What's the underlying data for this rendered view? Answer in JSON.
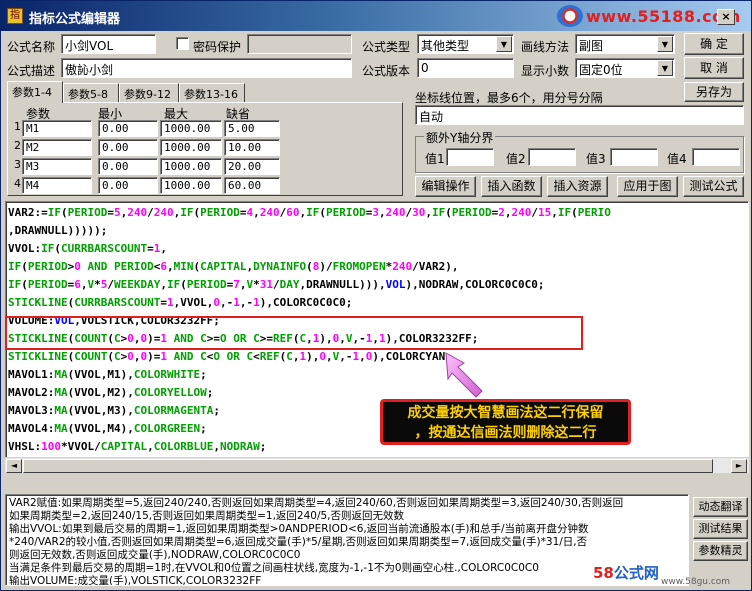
{
  "window": {
    "title": "指标公式编辑器",
    "watermark": "www.55188.com",
    "close_label": "×"
  },
  "form": {
    "name_label": "公式名称",
    "name_value": "小剑VOL",
    "password_label": "密码保护",
    "password_value": "",
    "desc_label": "公式描述",
    "desc_value": "傲訫小剑",
    "type_label": "公式类型",
    "type_value": "其他类型",
    "draw_label": "画线方法",
    "draw_value": "副图",
    "version_label": "公式版本",
    "version_value": "0",
    "decimals_label": "显示小数",
    "decimals_value": "固定0位",
    "confirm_label": "确  定",
    "cancel_label": "取  消",
    "saveas_label": "另存为"
  },
  "tabs": [
    "参数1-4",
    "参数5-8",
    "参数9-12",
    "参数13-16"
  ],
  "params": {
    "headers": [
      "参数",
      "最小",
      "最大",
      "缺省"
    ],
    "rows": [
      {
        "num": "1",
        "name": "M1",
        "min": "0.00",
        "max": "1000.00",
        "default": "5.00"
      },
      {
        "num": "2",
        "name": "M2",
        "min": "0.00",
        "max": "1000.00",
        "default": "10.00"
      },
      {
        "num": "3",
        "name": "M3",
        "min": "0.00",
        "max": "1000.00",
        "default": "20.00"
      },
      {
        "num": "4",
        "name": "M4",
        "min": "0.00",
        "max": "1000.00",
        "default": "60.00"
      }
    ]
  },
  "coords": {
    "label": "坐标线位置，最多6个，用分号分隔",
    "value": "自动"
  },
  "yaxis": {
    "legend": "额外Y轴分界",
    "labels": [
      "值1",
      "值2",
      "值3",
      "值4"
    ]
  },
  "toolbar": {
    "edit": "编辑操作",
    "insert_fn": "插入函数",
    "insert_res": "插入资源",
    "apply": "应用于图",
    "test": "测试公式"
  },
  "code_lines": [
    [
      {
        "t": "VAR2:="
      },
      {
        "t": "IF",
        "c": "fn"
      },
      {
        "t": "("
      },
      {
        "t": "PERIOD",
        "c": "fn"
      },
      {
        "t": "="
      },
      {
        "t": "5",
        "c": "num"
      },
      {
        "t": ","
      },
      {
        "t": "240",
        "c": "num"
      },
      {
        "t": "/"
      },
      {
        "t": "240",
        "c": "num"
      },
      {
        "t": ","
      },
      {
        "t": "IF",
        "c": "fn"
      },
      {
        "t": "("
      },
      {
        "t": "PERIOD",
        "c": "fn"
      },
      {
        "t": "="
      },
      {
        "t": "4",
        "c": "num"
      },
      {
        "t": ","
      },
      {
        "t": "240",
        "c": "num"
      },
      {
        "t": "/"
      },
      {
        "t": "60",
        "c": "num"
      },
      {
        "t": ","
      },
      {
        "t": "IF",
        "c": "fn"
      },
      {
        "t": "("
      },
      {
        "t": "PERIOD",
        "c": "fn"
      },
      {
        "t": "="
      },
      {
        "t": "3",
        "c": "num"
      },
      {
        "t": ","
      },
      {
        "t": "240",
        "c": "num"
      },
      {
        "t": "/"
      },
      {
        "t": "30",
        "c": "num"
      },
      {
        "t": ","
      },
      {
        "t": "IF",
        "c": "fn"
      },
      {
        "t": "("
      },
      {
        "t": "PERIOD",
        "c": "fn"
      },
      {
        "t": "="
      },
      {
        "t": "2",
        "c": "num"
      },
      {
        "t": ","
      },
      {
        "t": "240",
        "c": "num"
      },
      {
        "t": "/"
      },
      {
        "t": "15",
        "c": "num"
      },
      {
        "t": ","
      },
      {
        "t": "IF",
        "c": "fn"
      },
      {
        "t": "("
      },
      {
        "t": "PERIO",
        "c": "fn"
      }
    ],
    [
      {
        "t": ",DRAWNULL)))));"
      }
    ],
    [
      {
        "t": "VVOL:"
      },
      {
        "t": "IF",
        "c": "fn"
      },
      {
        "t": "("
      },
      {
        "t": "CURRBARSCOUNT",
        "c": "fn"
      },
      {
        "t": "="
      },
      {
        "t": "1",
        "c": "num"
      },
      {
        "t": ","
      }
    ],
    [
      {
        "t": "IF",
        "c": "fn"
      },
      {
        "t": "("
      },
      {
        "t": "PERIOD",
        "c": "fn"
      },
      {
        "t": ">"
      },
      {
        "t": "0",
        "c": "num"
      },
      {
        "t": " AND ",
        "c": "fn"
      },
      {
        "t": "PERIOD",
        "c": "fn"
      },
      {
        "t": "<"
      },
      {
        "t": "6",
        "c": "num"
      },
      {
        "t": ","
      },
      {
        "t": "MIN",
        "c": "fn"
      },
      {
        "t": "("
      },
      {
        "t": "CAPITAL",
        "c": "fn"
      },
      {
        "t": ","
      },
      {
        "t": "DYNAINFO",
        "c": "fn"
      },
      {
        "t": "("
      },
      {
        "t": "8",
        "c": "num"
      },
      {
        "t": ")/"
      },
      {
        "t": "FROMOPEN",
        "c": "fn"
      },
      {
        "t": "*"
      },
      {
        "t": "240",
        "c": "num"
      },
      {
        "t": "/VAR2),"
      }
    ],
    [
      {
        "t": "IF",
        "c": "fn"
      },
      {
        "t": "("
      },
      {
        "t": "PERIOD",
        "c": "fn"
      },
      {
        "t": "="
      },
      {
        "t": "6",
        "c": "num"
      },
      {
        "t": ","
      },
      {
        "t": "V",
        "c": "fn"
      },
      {
        "t": "*"
      },
      {
        "t": "5",
        "c": "num"
      },
      {
        "t": "/"
      },
      {
        "t": "WEEKDAY",
        "c": "fn"
      },
      {
        "t": ","
      },
      {
        "t": "IF",
        "c": "fn"
      },
      {
        "t": "("
      },
      {
        "t": "PERIOD",
        "c": "fn"
      },
      {
        "t": "="
      },
      {
        "t": "7",
        "c": "num"
      },
      {
        "t": ","
      },
      {
        "t": "V",
        "c": "fn"
      },
      {
        "t": "*"
      },
      {
        "t": "31",
        "c": "num"
      },
      {
        "t": "/"
      },
      {
        "t": "DAY",
        "c": "fn"
      },
      {
        "t": ",DRAWNULL))),"
      },
      {
        "t": "VOL",
        "c": "var"
      },
      {
        "t": "),NODRAW,COLORC0C0C0;"
      }
    ],
    [
      {
        "t": "STICKLINE",
        "c": "fn"
      },
      {
        "t": "("
      },
      {
        "t": "CURRBARSCOUNT",
        "c": "fn"
      },
      {
        "t": "="
      },
      {
        "t": "1",
        "c": "num"
      },
      {
        "t": ",VVOL,"
      },
      {
        "t": "0",
        "c": "num"
      },
      {
        "t": ",-"
      },
      {
        "t": "1",
        "c": "num"
      },
      {
        "t": ",-"
      },
      {
        "t": "1",
        "c": "num"
      },
      {
        "t": "),COLORC0C0C0;"
      }
    ],
    [
      {
        "t": "VOLUME:"
      },
      {
        "t": "VOL",
        "c": "var"
      },
      {
        "t": ",VOLSTICK,COLOR3232FF;"
      }
    ],
    [
      {
        "t": "STICKLINE",
        "c": "fn"
      },
      {
        "t": "("
      },
      {
        "t": "COUNT",
        "c": "fn"
      },
      {
        "t": "("
      },
      {
        "t": "C",
        "c": "fn"
      },
      {
        "t": ">"
      },
      {
        "t": "0",
        "c": "num"
      },
      {
        "t": ","
      },
      {
        "t": "0",
        "c": "num"
      },
      {
        "t": ")="
      },
      {
        "t": "1",
        "c": "num"
      },
      {
        "t": " AND ",
        "c": "fn"
      },
      {
        "t": "C",
        "c": "fn"
      },
      {
        "t": ">="
      },
      {
        "t": "O",
        "c": "fn"
      },
      {
        "t": " OR ",
        "c": "fn"
      },
      {
        "t": "C",
        "c": "fn"
      },
      {
        "t": ">="
      },
      {
        "t": "REF",
        "c": "fn"
      },
      {
        "t": "("
      },
      {
        "t": "C",
        "c": "fn"
      },
      {
        "t": ","
      },
      {
        "t": "1",
        "c": "num"
      },
      {
        "t": "),"
      },
      {
        "t": "0",
        "c": "num"
      },
      {
        "t": ","
      },
      {
        "t": "V",
        "c": "fn"
      },
      {
        "t": ",-"
      },
      {
        "t": "1",
        "c": "num"
      },
      {
        "t": ","
      },
      {
        "t": "1",
        "c": "num"
      },
      {
        "t": "),COLOR3232FF;"
      }
    ],
    [
      {
        "t": "STICKLINE",
        "c": "fn"
      },
      {
        "t": "("
      },
      {
        "t": "COUNT",
        "c": "fn"
      },
      {
        "t": "("
      },
      {
        "t": "C",
        "c": "fn"
      },
      {
        "t": ">"
      },
      {
        "t": "0",
        "c": "num"
      },
      {
        "t": ","
      },
      {
        "t": "0",
        "c": "num"
      },
      {
        "t": ")="
      },
      {
        "t": "1",
        "c": "num"
      },
      {
        "t": " AND ",
        "c": "fn"
      },
      {
        "t": "C",
        "c": "fn"
      },
      {
        "t": "<"
      },
      {
        "t": "O",
        "c": "fn"
      },
      {
        "t": " OR ",
        "c": "fn"
      },
      {
        "t": "C",
        "c": "fn"
      },
      {
        "t": "<"
      },
      {
        "t": "REF",
        "c": "fn"
      },
      {
        "t": "("
      },
      {
        "t": "C",
        "c": "fn"
      },
      {
        "t": ","
      },
      {
        "t": "1",
        "c": "num"
      },
      {
        "t": "),"
      },
      {
        "t": "0",
        "c": "num"
      },
      {
        "t": ","
      },
      {
        "t": "V",
        "c": "fn"
      },
      {
        "t": ",-"
      },
      {
        "t": "1",
        "c": "num"
      },
      {
        "t": ","
      },
      {
        "t": "0",
        "c": "num"
      },
      {
        "t": "),COLORCYAN;"
      }
    ],
    [
      {
        "t": "MAVOL1:"
      },
      {
        "t": "MA",
        "c": "fn"
      },
      {
        "t": "(VVOL,M1),"
      },
      {
        "t": "COLORWHITE",
        "c": "fn"
      },
      {
        "t": ";"
      }
    ],
    [
      {
        "t": "MAVOL2:"
      },
      {
        "t": "MA",
        "c": "fn"
      },
      {
        "t": "(VVOL,M2),"
      },
      {
        "t": "COLORYELLOW",
        "c": "fn"
      },
      {
        "t": ";"
      }
    ],
    [
      {
        "t": "MAVOL3:"
      },
      {
        "t": "MA",
        "c": "fn"
      },
      {
        "t": "(VVOL,M3),"
      },
      {
        "t": "COLORMAGENTA",
        "c": "fn"
      },
      {
        "t": ";"
      }
    ],
    [
      {
        "t": "MAVOL4:"
      },
      {
        "t": "MA",
        "c": "fn"
      },
      {
        "t": "(VVOL,M4),"
      },
      {
        "t": "COLORGREEN",
        "c": "fn"
      },
      {
        "t": ";"
      }
    ],
    [
      {
        "t": "VHSL:"
      },
      {
        "t": "100",
        "c": "num"
      },
      {
        "t": "*VVOL/"
      },
      {
        "t": "CAPITAL",
        "c": "fn"
      },
      {
        "t": ","
      },
      {
        "t": "COLORBLUE",
        "c": "fn"
      },
      {
        "t": ","
      },
      {
        "t": "NODRAW",
        "c": "fn"
      },
      {
        "t": ";"
      }
    ],
    [
      {
        "t": "VAMT:VVOL/"
      },
      {
        "t": "V",
        "c": "fn"
      },
      {
        "t": "*"
      },
      {
        "t": "AMOUNT",
        "c": "fn"
      },
      {
        "t": "/"
      },
      {
        "t": "10000",
        "c": "num"
      },
      {
        "t": ",COLORCYAN,NODRAW;"
      }
    ]
  ],
  "annotation": {
    "line1": "成交量按大智慧画法这二行保留",
    "line2": "，按通达信画法则删除这二行"
  },
  "description_lines": [
    "VAR2赋值:如果周期类型=5,返回240/240,否则返回如果周期类型=4,返回240/60,否则返回如果周期类型=3,返回240/30,否则返回",
    "如果周期类型=2,返回240/15,否则返回如果周期类型=1,返回240/5,否则返回无效数",
    "输出VVOL:如果到最后交易的周期=1,返回如果周期类型>0ANDPERIOD<6,返回当前流通股本(手)和总手/当前离开盘分钟数",
    "*240/VAR2的较小值,否则返回如果周期类型=6,返回成交量(手)*5/星期,否则返回如果周期类型=7,返回成交量(手)*31/日,否",
    "则返回无效数,否则返回成交量(手),NODRAW,COLORC0C0C0",
    "当满足条件到最后交易的周期=1时,在VVOL和0位置之间画柱状线,宽度为-1,-1不为0则画空心柱.,COLORC0C0C0",
    "输出VOLUME:成交量(手),VOLSTICK,COLOR3232FF"
  ],
  "side_buttons": {
    "translate": "动态翻译",
    "test_result": "测试结果",
    "param_help": "参数精灵"
  },
  "footer": {
    "logo_num": "58",
    "logo_text": "公式网",
    "url": "www.58gu.com"
  }
}
